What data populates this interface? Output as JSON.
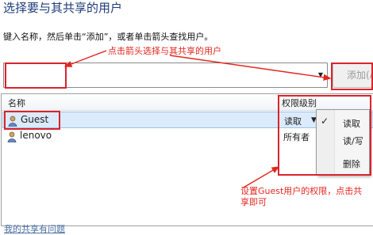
{
  "title": "选择要与其共享的用户",
  "instruction": "键入名称，然后单击“添加”，或者单击箭头查找用户。",
  "annotations": {
    "top": "点击箭头选择与其共享的用户",
    "bottom_line1": "设置Guest用户的权限，点击共",
    "bottom_line2": "享即可"
  },
  "combo": {
    "value": ""
  },
  "add_button": {
    "label": "添加(A)"
  },
  "table": {
    "headers": {
      "name": "名称",
      "permission": "权限级别"
    },
    "rows": [
      {
        "name": "Guest",
        "permission": "读取",
        "selected": true
      },
      {
        "name": "lenovo",
        "permission": "所有者",
        "selected": false
      }
    ]
  },
  "permission_menu": {
    "items": [
      {
        "label": "读取",
        "checked": true
      },
      {
        "label": "读/写",
        "checked": false
      },
      {
        "label": "删除",
        "checked": false
      }
    ]
  },
  "bottom_link": "我的共享有问题",
  "colors": {
    "annotation": "#e3261e",
    "selection": "#dcebfc",
    "title": "#1e3c78"
  },
  "icons": {
    "user": "user-icon",
    "check": "check-icon",
    "dropdown": "chevron-down-icon"
  }
}
